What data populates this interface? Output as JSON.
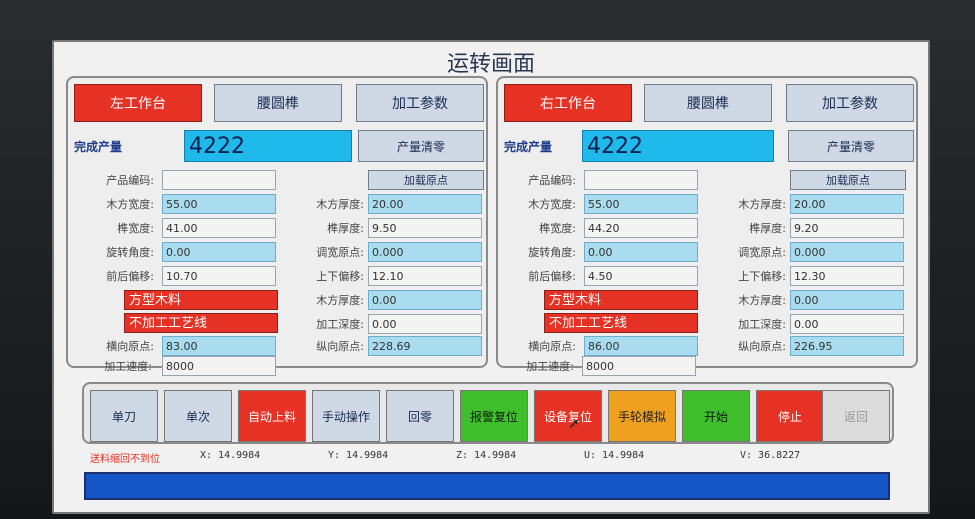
{
  "title": "运转画面",
  "left": {
    "tabs": [
      "左工作台",
      "腰圆榫",
      "加工参数"
    ],
    "production_label": "完成产量",
    "production_value": "4222",
    "clear_label": "产量清零",
    "load_origin_label": "加载原点",
    "fields_left": [
      {
        "label": "产品编码:",
        "value": ""
      },
      {
        "label": "木方宽度:",
        "value": "55.00"
      },
      {
        "label": "榫宽度:",
        "value": "41.00"
      },
      {
        "label": "旋转角度:",
        "value": "0.00"
      },
      {
        "label": "前后偏移:",
        "value": "10.70"
      }
    ],
    "material_type": "方型木料",
    "process_line": "不加工工艺线",
    "fields_left_bottom": [
      {
        "label": "横向原点:",
        "value": "83.00"
      },
      {
        "label": "加工速度:",
        "value": "8000"
      }
    ],
    "fields_right": [
      {
        "label": "木方厚度:",
        "value": "20.00"
      },
      {
        "label": "榫厚度:",
        "value": "9.50"
      },
      {
        "label": "调宽原点:",
        "value": "0.000"
      },
      {
        "label": "上下偏移:",
        "value": "12.10"
      },
      {
        "label": "木方厚度:",
        "value": "0.00"
      },
      {
        "label": "加工深度:",
        "value": "0.00"
      },
      {
        "label": "纵向原点:",
        "value": "228.69"
      }
    ]
  },
  "right": {
    "tabs": [
      "右工作台",
      "腰圆榫",
      "加工参数"
    ],
    "production_label": "完成产量",
    "production_value": "4222",
    "clear_label": "产量清零",
    "load_origin_label": "加载原点",
    "fields_left": [
      {
        "label": "产品编码:",
        "value": ""
      },
      {
        "label": "木方宽度:",
        "value": "55.00"
      },
      {
        "label": "榫宽度:",
        "value": "44.20"
      },
      {
        "label": "旋转角度:",
        "value": "0.00"
      },
      {
        "label": "前后偏移:",
        "value": "4.50"
      }
    ],
    "material_type": "方型木料",
    "process_line": "不加工工艺线",
    "fields_left_bottom": [
      {
        "label": "横向原点:",
        "value": "86.00"
      },
      {
        "label": "加工速度:",
        "value": "8000"
      }
    ],
    "fields_right": [
      {
        "label": "木方厚度:",
        "value": "20.00"
      },
      {
        "label": "榫厚度:",
        "value": "9.20"
      },
      {
        "label": "调宽原点:",
        "value": "0.000"
      },
      {
        "label": "上下偏移:",
        "value": "12.30"
      },
      {
        "label": "木方厚度:",
        "value": "0.00"
      },
      {
        "label": "加工深度:",
        "value": "0.00"
      },
      {
        "label": "纵向原点:",
        "value": "226.95"
      }
    ]
  },
  "controls": [
    {
      "label": "单刀",
      "style": "normal"
    },
    {
      "label": "单次",
      "style": "normal"
    },
    {
      "label": "自动上料",
      "style": "red"
    },
    {
      "label": "手动操作",
      "style": "normal"
    },
    {
      "label": "回零",
      "style": "normal"
    },
    {
      "label": "报警复位",
      "style": "green"
    },
    {
      "label": "设备复位",
      "style": "red"
    },
    {
      "label": "手轮模拟",
      "style": "orange"
    },
    {
      "label": "开始",
      "style": "green"
    },
    {
      "label": "停止",
      "style": "red"
    },
    {
      "label": "返回",
      "style": "disabled"
    }
  ],
  "status": {
    "alarm": "送料缩回不到位",
    "x": "X:   14.9984",
    "y": "Y:   14.9984",
    "z": "Z:   14.9984",
    "u": "U:   14.9984",
    "v": "V:   36.8227"
  },
  "colors": {
    "accent_red": "#e53224",
    "accent_green": "#3fbf2c",
    "accent_orange": "#f0a01f",
    "value_blue": "#1fb9ec",
    "progress_blue": "#1556c7"
  }
}
